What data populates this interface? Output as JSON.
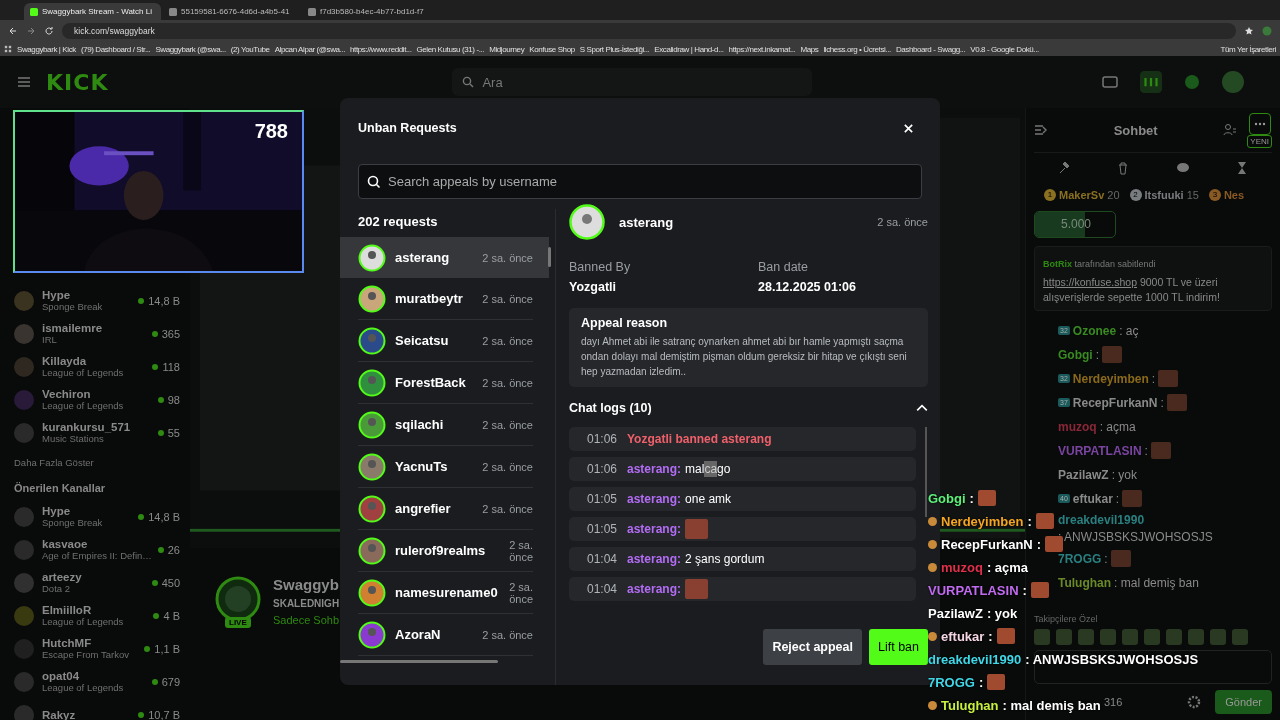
{
  "browser": {
    "tabs": [
      {
        "title": "Swaggybark Stream - Watch Li",
        "selected": true
      },
      {
        "title": "55159581-6676-4d6d-a4b5-41",
        "selected": false
      },
      {
        "title": "f7d3b580-b4ec-4b77-bd1d-f7",
        "selected": false
      }
    ],
    "address": "kick.com/swaggybark",
    "bookmarks": [
      "Swaggybark | Kick",
      "(79) Dashboard / Str...",
      "Swaggybark (@swa...",
      "(2) YouTube",
      "Alpcan Alpar (@swa...",
      "https://www.reddit...",
      "Gelen Kutusu (31) -...",
      "Midjourney",
      "Konfuse Shop",
      "S Sport Plus-İstediği...",
      "Excalidraw | Hand-d...",
      "https://next.inkamat...",
      "Maps",
      "lichess.org • Ücretsi...",
      "Dashboard - Swagg...",
      "V0.8 - Google Dokü..."
    ],
    "all_bookmarks": "Tüm Yer İşaretleri"
  },
  "header": {
    "logo": "KICK",
    "search_placeholder": "Ara"
  },
  "webcam": {
    "viewer_count": "788"
  },
  "sidebar": {
    "followed": [
      {
        "name": "Hype",
        "category": "Sponge Break",
        "viewers": "14,8 B"
      },
      {
        "name": "ismailemre",
        "category": "IRL",
        "viewers": "365"
      },
      {
        "name": "Killayda",
        "category": "League of Legends",
        "viewers": "118"
      },
      {
        "name": "Vechiron",
        "category": "League of Legends",
        "viewers": "98"
      },
      {
        "name": "kurankursu_571",
        "category": "Music Stations",
        "viewers": "55"
      }
    ],
    "show_more": "Daha Fazla Göster",
    "recommended_title": "Önerilen Kanallar",
    "recommended": [
      {
        "name": "Hype",
        "category": "Sponge Break",
        "viewers": "14,8 B"
      },
      {
        "name": "kasvaoe",
        "category": "Age of Empires II: Defin…",
        "viewers": "26"
      },
      {
        "name": "arteezy",
        "category": "Dota 2",
        "viewers": "450"
      },
      {
        "name": "ElmiilloR",
        "category": "League of Legends",
        "viewers": "4 B"
      },
      {
        "name": "HutchMF",
        "category": "Escape From Tarkov",
        "viewers": "1,1 B"
      },
      {
        "name": "opat04",
        "category": "League of Legends",
        "viewers": "679"
      },
      {
        "name": "Rakyz",
        "viewers": "10,7 B"
      }
    ]
  },
  "channel": {
    "name": "Swaggyb",
    "title": "SKALEDNIGH",
    "category": "Sadece Sohb",
    "live_badge": "LIVE"
  },
  "chat": {
    "title": "Sohbet",
    "new_badge": "YENI",
    "leaders": [
      {
        "rank": "1",
        "name": "MakerSv",
        "count": "20",
        "color": "#8a7020"
      },
      {
        "rank": "2",
        "name": "Itsfuuki",
        "count": "15",
        "color": "#7a7d80"
      },
      {
        "rank": "3",
        "name": "Nes",
        "color": "#8a5a25"
      }
    ],
    "goal": {
      "amount": "5.000",
      "level": 0.62
    },
    "pinned": {
      "by": "BotRix",
      "note": "tarafından sabitlendi",
      "link": "https://konfuse.shop",
      "text": " 9000 TL ve üzeri alışverişlerde sepette 1000 TL indirim!"
    },
    "messages": [
      {
        "badge": "32",
        "user": "Ozonee",
        "color": "#3a8a22",
        "text": ": aç",
        "emote": false
      },
      {
        "user": "Gobgi",
        "color": "#3a8a22",
        "text": ":",
        "emote": true
      },
      {
        "badge": "32",
        "user": "Nerdeyimben",
        "color": "#8a6a1a",
        "text": ":",
        "emote": true
      },
      {
        "badge": "37",
        "user": "RecepFurkanN",
        "color": "#8a8a8a",
        "text": ":",
        "emote": true
      },
      {
        "user": "muzoq",
        "color": "#8a2838",
        "text": ": açma",
        "emote": false
      },
      {
        "user": "VURPATLASIN",
        "color": "#7a45a0",
        "text": ":",
        "emote": true
      },
      {
        "user": "PazilawZ",
        "color": "#8a8a8a",
        "text": ": yok",
        "emote": false
      },
      {
        "badge": "40",
        "user": "eftukar",
        "color": "#8a8a8a",
        "text": ":",
        "emote": true
      },
      {
        "user": "dreakdevil1990",
        "color": "#2a8080",
        "text": ": ANWJSBSKSJWOHSOSJS",
        "emote": false
      },
      {
        "user": "7ROGG",
        "color": "#2a8080",
        "text": ":",
        "emote": true
      },
      {
        "user": "Tulughan",
        "color": "#6a8a2a",
        "text": ": mal demiş ban",
        "emote": false
      }
    ],
    "followers_only": "Takipçilere Özel",
    "viewers": "316",
    "send": "Gönder"
  },
  "modal": {
    "title": "Unban Requests",
    "search_placeholder": "Search appeals by username",
    "count": "202 requests",
    "requests": [
      {
        "name": "asterang",
        "time": "2 sa. önce",
        "selected": true
      },
      {
        "name": "muratbeytr",
        "time": "2 sa. önce",
        "selected": false
      },
      {
        "name": "Seicatsu",
        "time": "2 sa. önce",
        "selected": false
      },
      {
        "name": "ForestBack",
        "time": "2 sa. önce",
        "selected": false
      },
      {
        "name": "sqilachi",
        "time": "2 sa. önce",
        "selected": false
      },
      {
        "name": "YacnuTs",
        "time": "2 sa. önce",
        "selected": false
      },
      {
        "name": "angrefier",
        "time": "2 sa. önce",
        "selected": false
      },
      {
        "name": "rulerof9realms",
        "time": "2 sa. önce",
        "selected": false
      },
      {
        "name": "namesurename0",
        "time": "2 sa. önce",
        "selected": false
      },
      {
        "name": "AzoraN",
        "time": "2 sa. önce",
        "selected": false
      }
    ],
    "detail": {
      "name": "asterang",
      "time": "2 sa. önce",
      "banned_by_label": "Banned By",
      "banned_by": "Yozgatli",
      "ban_date_label": "Ban date",
      "ban_date": "28.12.2025 01:06",
      "reason_title": "Appeal reason",
      "reason": "dayı Ahmet abi ile satranç oynarken ahmet abi bır hamle yapmıştı saçma ondan dolayı mal demiştim pişman oldum gereksiz bir hitap ve çıkıştı seni hep yazmadan izledim..",
      "logs_title": "Chat logs (10)",
      "logs_expanded": true,
      "logs": [
        {
          "kind": "ban",
          "time": "01:06",
          "text": "Yozgatli banned asterang"
        },
        {
          "kind": "message",
          "time": "01:06",
          "user": "asterang:",
          "parts": [
            {
              "text": "mal",
              "highlighted": false
            },
            {
              "text": "ca",
              "highlighted": true
            },
            {
              "text": "go",
              "highlighted": false
            }
          ]
        },
        {
          "kind": "message",
          "time": "01:05",
          "user": "asterang:",
          "parts": [
            {
              "text": "one amk",
              "highlighted": false
            }
          ]
        },
        {
          "kind": "emote",
          "time": "01:05",
          "user": "asterang:"
        },
        {
          "kind": "message",
          "time": "01:04",
          "user": "asterang:",
          "parts": [
            {
              "text": "2 şans gordum",
              "highlighted": false
            }
          ]
        },
        {
          "kind": "emote",
          "time": "01:04",
          "user": "asterang:"
        }
      ]
    },
    "reject": "Reject appeal",
    "lift": "Lift ban"
  },
  "overlay_chat": [
    {
      "badge": false,
      "user": "Gobgi",
      "color": "#5ef07a",
      "text": ":",
      "emote": true
    },
    {
      "badge": true,
      "user": "Nerdeyimben",
      "color": "#f5a623",
      "text": ":",
      "emote": true
    },
    {
      "badge": true,
      "user": "RecepFurkanN",
      "color": "#ffffff",
      "text": ":",
      "emote": true
    },
    {
      "badge": true,
      "user": "muzoq",
      "color": "#e0304a",
      "text": ": açma",
      "emote": false
    },
    {
      "badge": false,
      "user": "VURPATLASIN",
      "color": "#c06bf0",
      "text": ":",
      "emote": true
    },
    {
      "badge": false,
      "user": "PazilawZ",
      "color": "#ffffff",
      "text": ": yok",
      "emote": false
    },
    {
      "badge": true,
      "user": "eftukar",
      "color": "#f4d6e4",
      "text": ":",
      "emote": true
    },
    {
      "badge": false,
      "user": "dreakdevil1990",
      "color": "#40d8e8",
      "text": ": ANWJSBSKSJWOHSOSJS",
      "emote": false
    },
    {
      "badge": false,
      "user": "7ROGG",
      "color": "#40d8e8",
      "text": ":",
      "emote": true
    },
    {
      "badge": true,
      "user": "Tulughan",
      "color": "#c8f040",
      "text": ": mal demiş ban",
      "emote": false
    }
  ]
}
